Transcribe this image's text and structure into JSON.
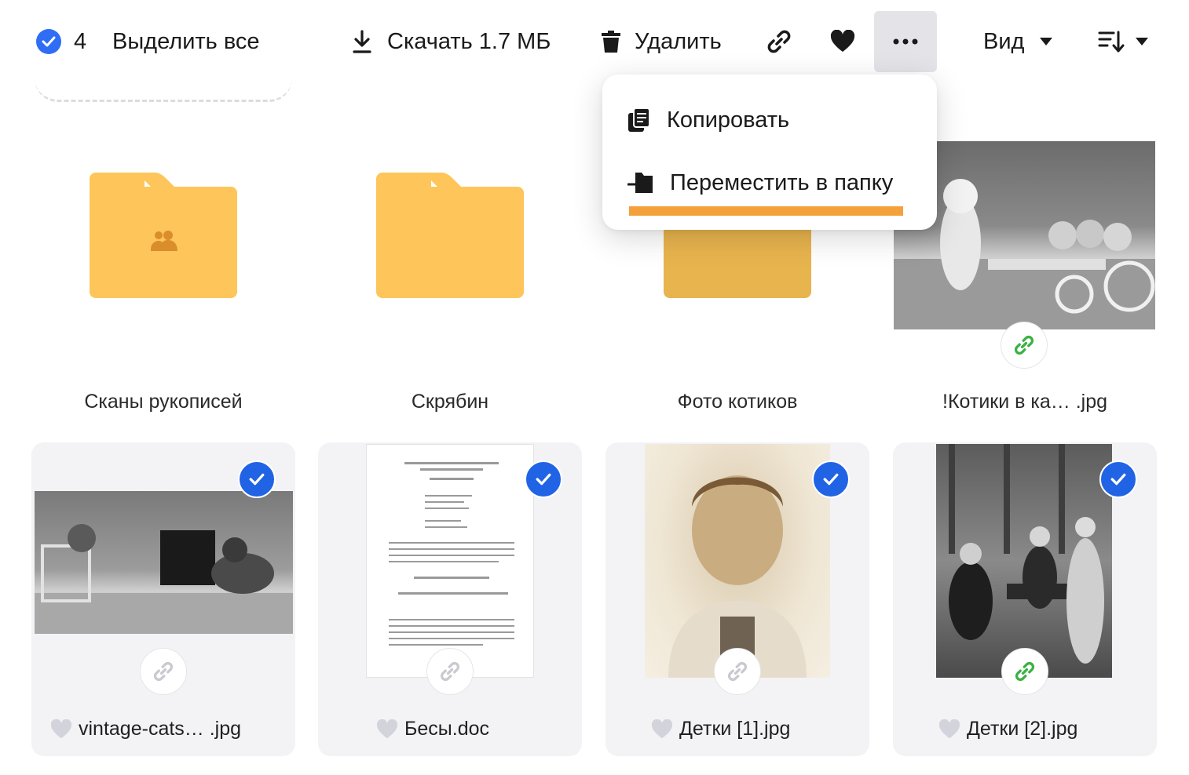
{
  "toolbar": {
    "selected_count": "4",
    "select_all_label": "Выделить все",
    "download_label": "Скачать 1.7 МБ",
    "delete_label": "Удалить",
    "view_label": "Вид"
  },
  "menu": {
    "copy_label": "Копировать",
    "move_label": "Переместить в папку"
  },
  "folders": [
    {
      "name": "Сканы рукописей",
      "shared": true
    },
    {
      "name": "Скрябин",
      "shared": false
    },
    {
      "name": "Фото котиков",
      "shared": false
    }
  ],
  "top_file": {
    "name": "!Котики в ка… .jpg",
    "link_color": "#3bb143"
  },
  "files": [
    {
      "name": "vintage-cats… .jpg",
      "selected": true,
      "link_color": "#c9c9cf"
    },
    {
      "name": "Бесы.doc",
      "selected": true,
      "link_color": "#c9c9cf"
    },
    {
      "name": "Детки [1].jpg",
      "selected": true,
      "link_color": "#c9c9cf"
    },
    {
      "name": "Детки [2].jpg",
      "selected": true,
      "link_color": "#3bb143"
    }
  ],
  "colors": {
    "accent": "#2063e5",
    "folder": "#fdc55a",
    "highlight": "#f4a03b"
  }
}
